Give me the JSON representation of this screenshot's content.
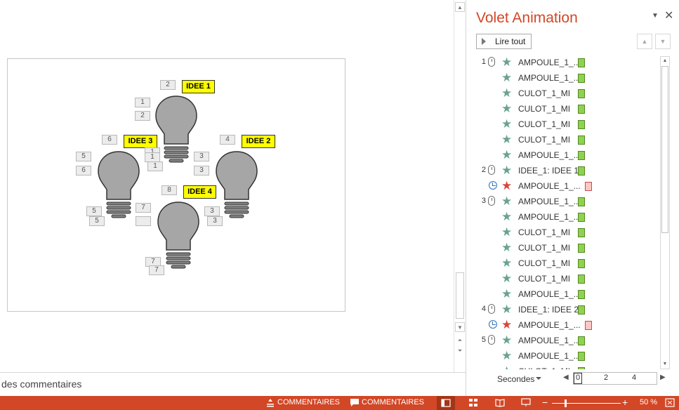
{
  "slide": {
    "ideas": [
      "IDEE 1",
      "IDEE 2",
      "IDEE 3",
      "IDEE 4"
    ],
    "order_tags": [
      "1",
      "1",
      "1",
      "1",
      "2",
      "2",
      "3",
      "3",
      "3",
      "3",
      "3",
      "4",
      "5",
      "5",
      "5",
      "5",
      "6",
      "6",
      "7",
      "7",
      "7",
      "7",
      "8"
    ]
  },
  "notes": {
    "text": "des commentaires"
  },
  "pane": {
    "title": "Volet Animation",
    "menu_icon": "dropdown-caret-icon",
    "close_icon": "close-icon",
    "play_label": "Lire tout",
    "up_icon": "move-up-icon",
    "down_icon": "move-down-icon",
    "items": [
      {
        "seq": "1",
        "trigger": "mouse",
        "effect": "entry",
        "name": "AMPOULE_1_..."
      },
      {
        "seq": "",
        "trigger": "",
        "effect": "entry",
        "name": "AMPOULE_1_..."
      },
      {
        "seq": "",
        "trigger": "",
        "effect": "entry",
        "name": "CULOT_1_MI"
      },
      {
        "seq": "",
        "trigger": "",
        "effect": "entry",
        "name": "CULOT_1_MI"
      },
      {
        "seq": "",
        "trigger": "",
        "effect": "entry",
        "name": "CULOT_1_MI"
      },
      {
        "seq": "",
        "trigger": "",
        "effect": "entry",
        "name": "CULOT_1_MI"
      },
      {
        "seq": "",
        "trigger": "",
        "effect": "entry",
        "name": "AMPOULE_1_..."
      },
      {
        "seq": "2",
        "trigger": "mouse",
        "effect": "entry",
        "name": "IDEE_1: IDEE 1"
      },
      {
        "seq": "",
        "trigger": "clock",
        "effect": "emphasis",
        "name": "AMPOULE_1_..."
      },
      {
        "seq": "3",
        "trigger": "mouse",
        "effect": "entry",
        "name": "AMPOULE_1_..."
      },
      {
        "seq": "",
        "trigger": "",
        "effect": "entry",
        "name": "AMPOULE_1_..."
      },
      {
        "seq": "",
        "trigger": "",
        "effect": "entry",
        "name": "CULOT_1_MI"
      },
      {
        "seq": "",
        "trigger": "",
        "effect": "entry",
        "name": "CULOT_1_MI"
      },
      {
        "seq": "",
        "trigger": "",
        "effect": "entry",
        "name": "CULOT_1_MI"
      },
      {
        "seq": "",
        "trigger": "",
        "effect": "entry",
        "name": "CULOT_1_MI"
      },
      {
        "seq": "",
        "trigger": "",
        "effect": "entry",
        "name": "AMPOULE_1_..."
      },
      {
        "seq": "4",
        "trigger": "mouse",
        "effect": "entry",
        "name": "IDEE_1: IDEE 2"
      },
      {
        "seq": "",
        "trigger": "clock",
        "effect": "emphasis",
        "name": "AMPOULE_1_..."
      },
      {
        "seq": "5",
        "trigger": "mouse",
        "effect": "entry",
        "name": "AMPOULE_1_..."
      },
      {
        "seq": "",
        "trigger": "",
        "effect": "entry",
        "name": "AMPOULE_1_..."
      },
      {
        "seq": "",
        "trigger": "",
        "effect": "entry",
        "name": "CULOT_1_MI"
      }
    ],
    "timeline": {
      "label": "Secondes",
      "ticks": [
        "0",
        "2",
        "4"
      ]
    }
  },
  "status": {
    "notes_label": "COMMENTAIRES",
    "comments_label": "COMMENTAIRES",
    "zoom": "50 %"
  },
  "colors": {
    "accent": "#d24726",
    "entry_star": "#6aa38f",
    "emphasis_star": "#d9463b",
    "entry_bar": "#92d050",
    "emphasis_bar": "#ffc7c3"
  }
}
